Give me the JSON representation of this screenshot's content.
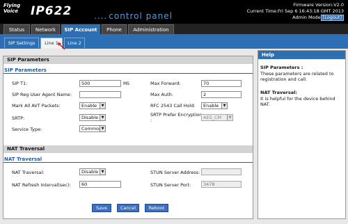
{
  "header": {
    "brand_top": "Flying Voice",
    "model": "IP622",
    "title": "control panel",
    "firmware": "Firmware Version:V2.0",
    "time": "Current Time:Fri Sep 6 16:43:18 GMT 2013",
    "mode": "Admin Mode",
    "logout": "[Logout]"
  },
  "main_tabs": [
    {
      "label": "Status",
      "active": false
    },
    {
      "label": "Network",
      "active": false
    },
    {
      "label": "SIP Account",
      "active": true
    },
    {
      "label": "Phone",
      "active": false
    },
    {
      "label": "Administration",
      "active": false
    }
  ],
  "sub_tabs": [
    {
      "label": "SIP Settings",
      "active": false
    },
    {
      "label": "Line 1",
      "active": true
    },
    {
      "label": "Line 2",
      "active": false
    }
  ],
  "sip": {
    "section_title": "SIP Parameters",
    "sub_title": "SIP Parameters",
    "t1_label": "SIP T1:",
    "t1_value": "500",
    "t1_unit": "MS",
    "max_forward_label": "Max Forward:",
    "max_forward_value": "70",
    "ua_label": "SIP Reg User Agent Name:",
    "ua_value": "",
    "max_auth_label": "Max Auth:",
    "max_auth_value": "2",
    "mark_avt_label": "Mark All AVT Packets:",
    "mark_avt_value": "Enable",
    "rfc_label": "RFC 2543 Call Hold:",
    "rfc_value": "Enable",
    "srtp_label": "SRTP:",
    "srtp_value": "Disable",
    "srtp_enc_label_1": "SRTP Prefer Encryption",
    "srtp_enc_label_2": ":",
    "srtp_enc_value": "AES_CM",
    "service_label": "Service Type:",
    "service_value": "Common"
  },
  "nat": {
    "section_title": "NAT Traversal",
    "sub_title": "NAT Traversal",
    "nat_label": "NAT Traversal:",
    "nat_value": "Disable",
    "stun_addr_label": "STUN Server Address:",
    "stun_addr_value": "",
    "refresh_label": "NAT Refresh Interval(sec):",
    "refresh_value": "60",
    "stun_port_label": "STUN Server Port:",
    "stun_port_value": "3478"
  },
  "actions": {
    "save": "Save",
    "cancel": "Cancel",
    "reboot": "Reboot"
  },
  "help": {
    "title": "Help",
    "sip_heading": "SIP Parameters :",
    "sip_text": "These parameters are related to registration and call.",
    "nat_heading": "NAT Traversal:",
    "nat_text": "It is helpful for the device behind NAT."
  },
  "colors": {
    "header_bg": "#000000",
    "accent": "#2d6fb5",
    "button": "#3a6fc4",
    "arrow": "#d21c1c"
  }
}
